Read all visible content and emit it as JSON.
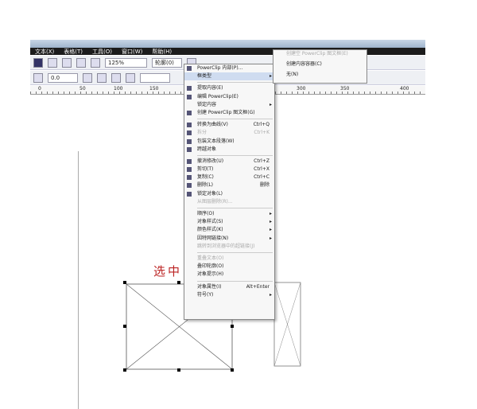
{
  "menubar": [
    "文本(X)",
    "表格(T)",
    "工具(O)",
    "窗口(W)",
    "帮助(H)"
  ],
  "toolbar": {
    "zoom": "125%",
    "outline": "轮廓(0)",
    "angle": "0.0"
  },
  "ruler": [
    "0",
    "50",
    "100",
    "150",
    "200",
    "250",
    "300",
    "350",
    "400"
  ],
  "canvas_text": "选中",
  "context_menu": [
    {
      "label": "PowerClip 内部(P)...",
      "icon": "powerclip-icon"
    },
    {
      "label": "框类型",
      "arrow": true,
      "highlight": true
    },
    {
      "sep": true
    },
    {
      "label": "提取内容(E)",
      "icon": "extract-icon"
    },
    {
      "label": "编辑 PowerClip(E)",
      "icon": "edit-icon"
    },
    {
      "label": "锁定内容",
      "arrow": true
    },
    {
      "label": "创建 PowerClip 图文框(G)",
      "icon": "frame-icon"
    },
    {
      "sep": true
    },
    {
      "label": "转换为曲线(V)",
      "shortcut": "Ctrl+Q",
      "icon": "curve-icon"
    },
    {
      "label": "拆分",
      "shortcut": "Ctrl+K",
      "disabled": true,
      "icon": "split-icon"
    },
    {
      "label": "包装文本段落(W)",
      "icon": "wrap-icon"
    },
    {
      "label": "跨越对象",
      "icon": "span-icon"
    },
    {
      "sep": true
    },
    {
      "label": "撤消修改(U)",
      "shortcut": "Ctrl+Z",
      "icon": "undo-icon"
    },
    {
      "label": "剪切(T)",
      "shortcut": "Ctrl+X",
      "icon": "cut-icon"
    },
    {
      "label": "复制(C)",
      "shortcut": "Ctrl+C",
      "icon": "copy-icon"
    },
    {
      "label": "删除(L)",
      "shortcut": "删除",
      "icon": "delete-icon"
    },
    {
      "label": "锁定对象(L)",
      "icon": "lock-icon"
    },
    {
      "label": "从图层删除(R)...",
      "disabled": true
    },
    {
      "sep": true
    },
    {
      "label": "顺序(O)",
      "arrow": true
    },
    {
      "label": "对象样式(S)",
      "arrow": true
    },
    {
      "label": "颜色样式(K)",
      "arrow": true
    },
    {
      "label": "因特网链接(N)",
      "arrow": true
    },
    {
      "label": "跳转到浏览器中的超链接(J)",
      "disabled": true
    },
    {
      "sep": true
    },
    {
      "label": "重叠文本(O)",
      "disabled": true
    },
    {
      "label": "叠印轮廓(O)"
    },
    {
      "label": "对象提示(H)"
    },
    {
      "sep": true
    },
    {
      "label": "对象属性(I)",
      "shortcut": "Alt+Enter"
    },
    {
      "label": "符号(Y)",
      "arrow": true
    }
  ],
  "submenu": [
    {
      "label": "创建空 PowerClip 图文框(E)",
      "disabled": true
    },
    {
      "label": "创建内容容器(C)"
    },
    {
      "label": "无(N)"
    }
  ]
}
